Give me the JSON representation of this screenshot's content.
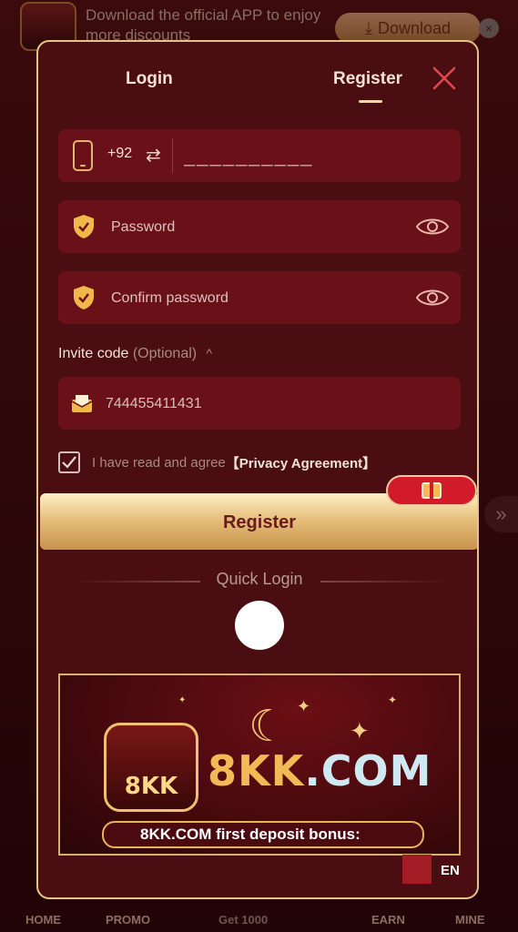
{
  "banner": {
    "text": "Download the official APP to enjoy more discounts",
    "download_label": "Download",
    "close_glyph": "×"
  },
  "bottom_nav": {
    "home": "HOME",
    "promo": "PROMO",
    "earn_amount": "Get 1000",
    "earn": "EARN",
    "mine": "MINE"
  },
  "modal": {
    "tabs": {
      "login": "Login",
      "register": "Register"
    },
    "phone": {
      "country_code": "+92",
      "placeholder": "__________"
    },
    "password": {
      "placeholder": "Password"
    },
    "confirm": {
      "placeholder": "Confirm password"
    },
    "invite": {
      "label": "Invite code",
      "optional": "(Optional)",
      "value": "744455411431"
    },
    "agreement": {
      "text": "I have read and agree",
      "link": "【Privacy Agreement】",
      "checked": true
    },
    "register_button": "Register",
    "quick_login": "Quick Login",
    "promo": {
      "brand_part1": "8KK",
      "brand_part2": ".COM",
      "badge": "8KK",
      "deposit_brand": "8KK.COM",
      "deposit_text": "first deposit bonus:"
    },
    "language": "EN"
  },
  "colors": {
    "gold": "#e7c485",
    "panel": "#4a0d12",
    "field": "#6a1018",
    "accent_red": "#d11a2a"
  }
}
